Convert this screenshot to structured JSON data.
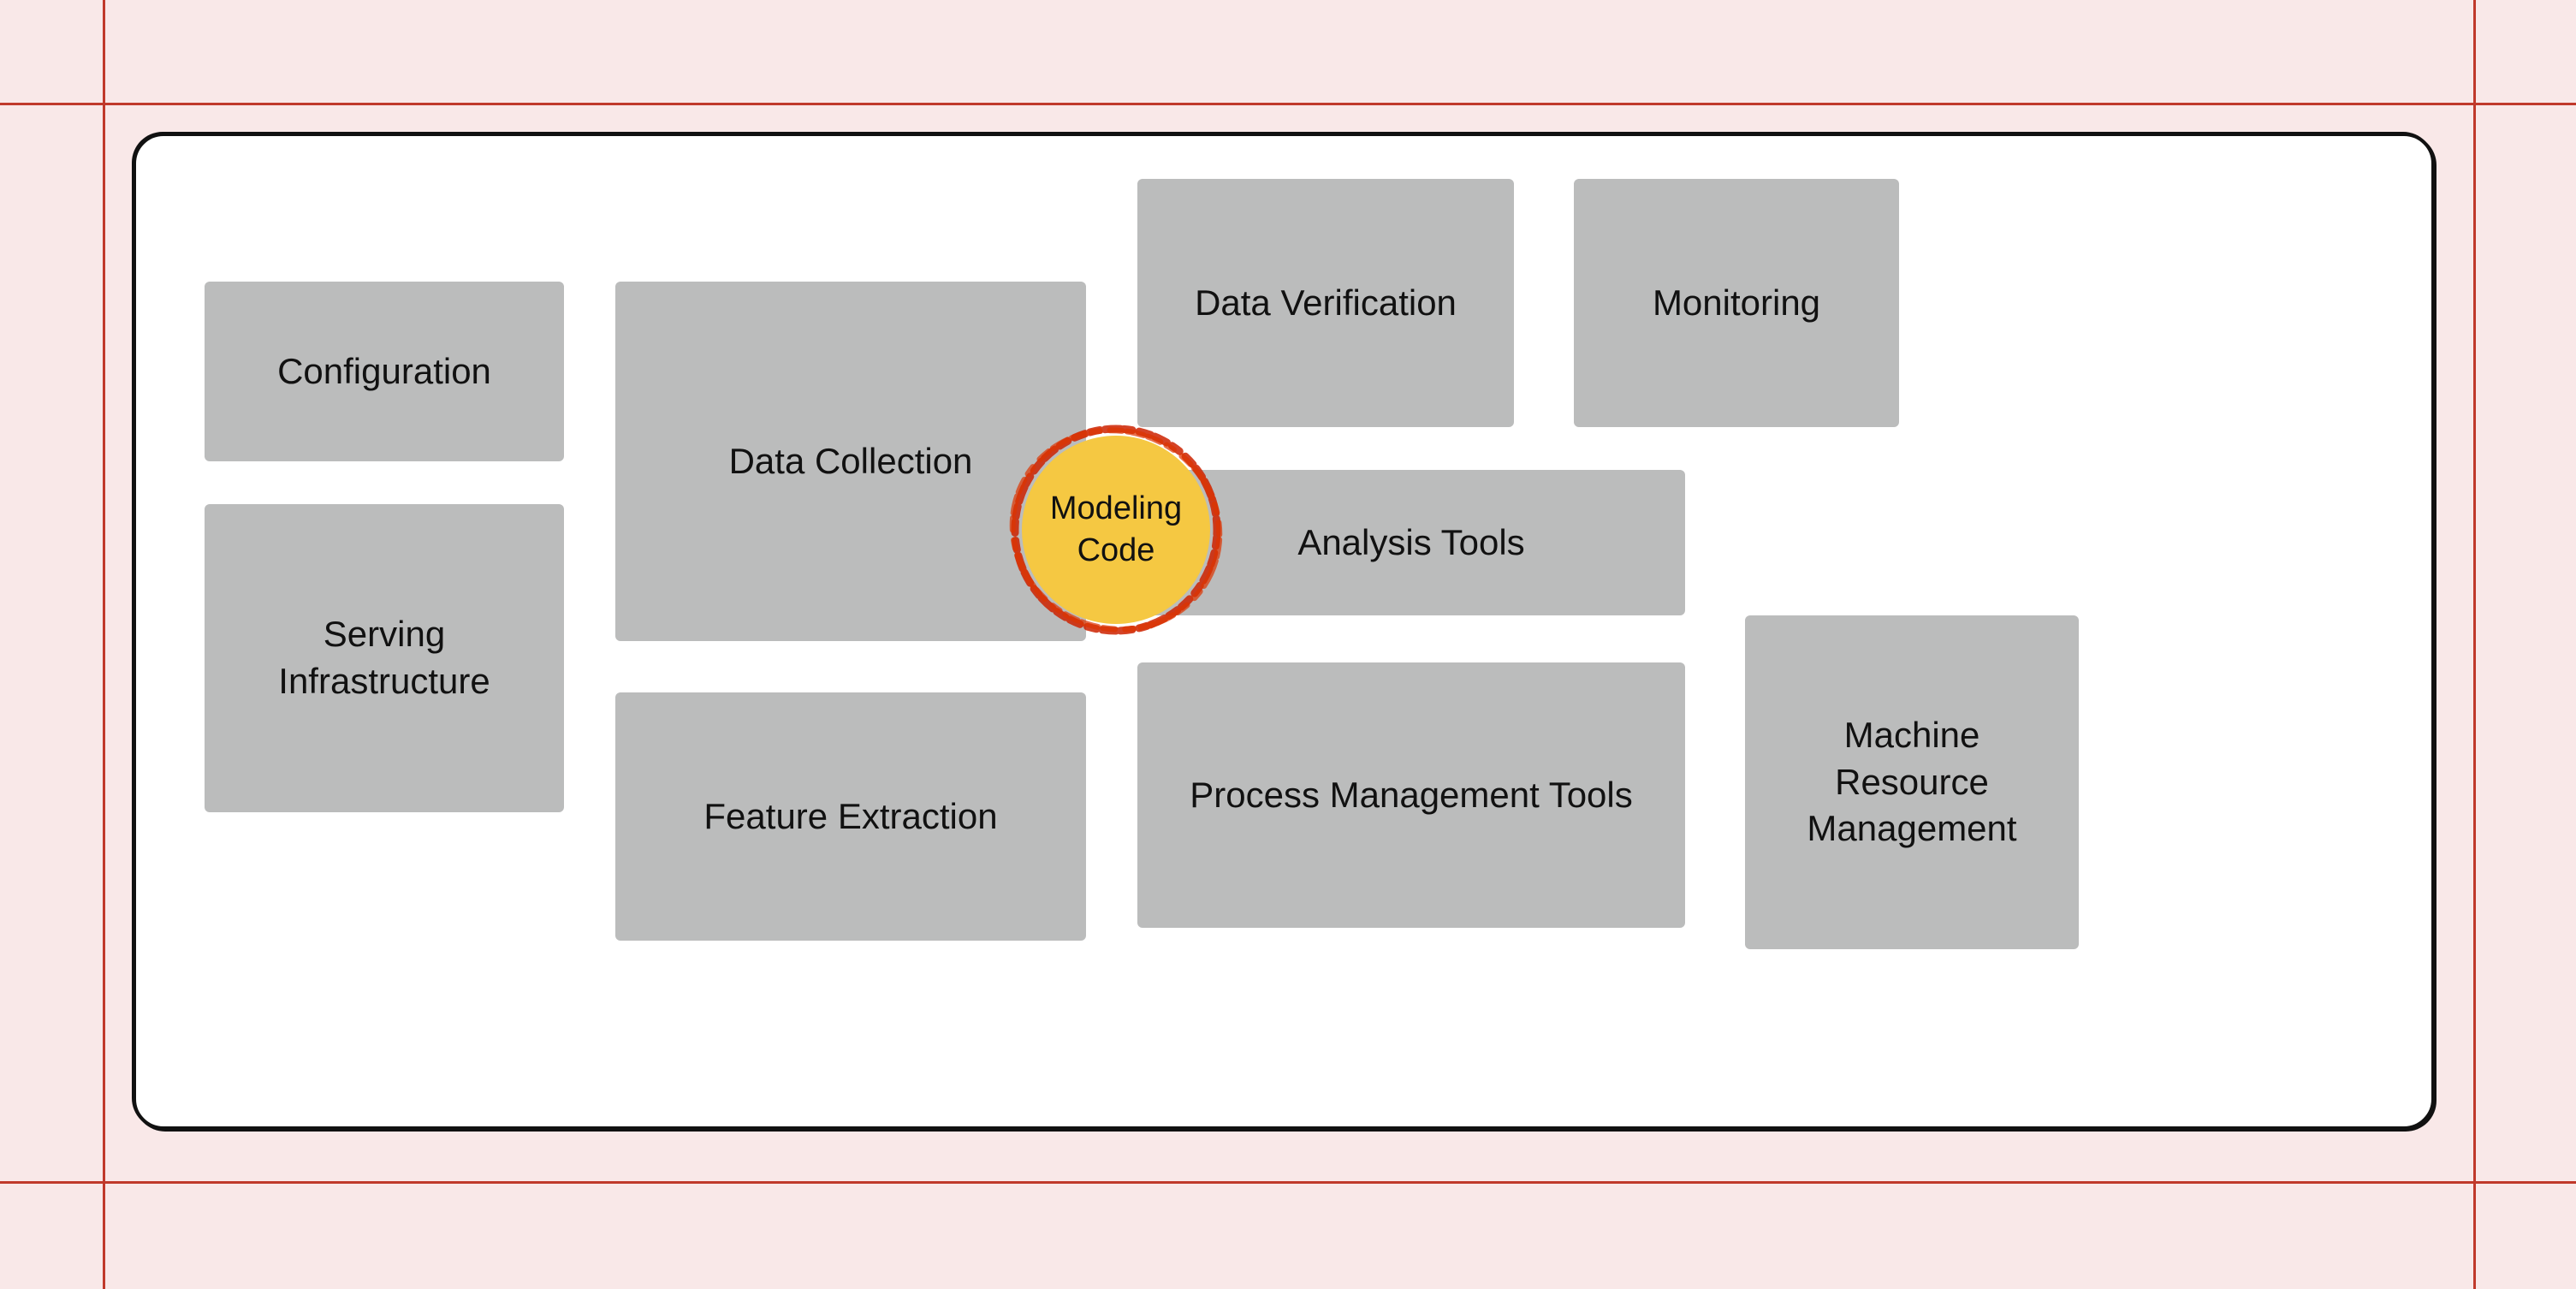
{
  "background_color": "#f9e8e8",
  "boxes": {
    "configuration": {
      "label": "Configuration"
    },
    "serving_infrastructure": {
      "label": "Serving\nInfrastructure"
    },
    "data_collection": {
      "label": "Data Collection"
    },
    "data_verification": {
      "label": "Data Verification"
    },
    "monitoring": {
      "label": "Monitoring"
    },
    "analysis_tools": {
      "label": "Analysis Tools"
    },
    "process_management_tools": {
      "label": "Process Management Tools"
    },
    "feature_extraction": {
      "label": "Feature Extraction"
    },
    "machine_resource_management": {
      "label": "Machine Resource\nManagement"
    },
    "modeling_code": {
      "label": "Modeling\nCode"
    }
  }
}
